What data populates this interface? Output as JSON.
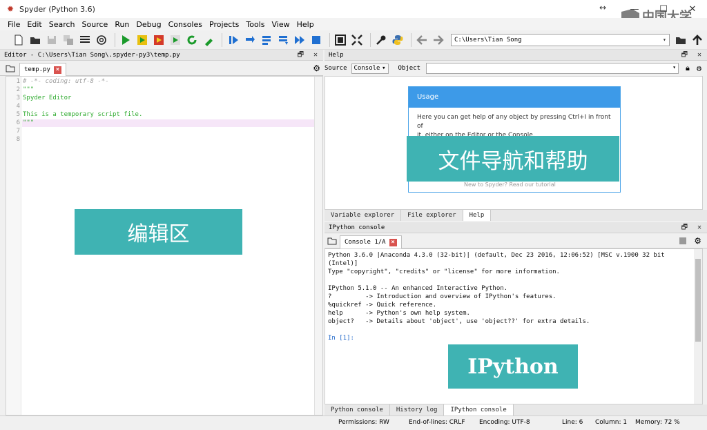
{
  "window": {
    "title": "Spyder (Python 3.6)",
    "resize_hint": "↔",
    "minimize": "—",
    "maximize": "☐",
    "close": "✕"
  },
  "watermark": {
    "text": "中国大学"
  },
  "menu": [
    "File",
    "Edit",
    "Search",
    "Source",
    "Run",
    "Debug",
    "Consoles",
    "Projects",
    "Tools",
    "View",
    "Help"
  ],
  "toolbar": {
    "path": "C:\\Users\\Tian Song"
  },
  "editor": {
    "pane_title": "Editor - C:\\Users\\Tian Song\\.spyder-py3\\temp.py",
    "pane_buttons": "🗗 ✕",
    "tab_label": "temp.py",
    "lines": [
      {
        "n": "1",
        "text": "# -*- coding: utf-8 -*-"
      },
      {
        "n": "2",
        "text": "\"\"\""
      },
      {
        "n": "3",
        "text": "Spyder Editor"
      },
      {
        "n": "4",
        "text": ""
      },
      {
        "n": "5",
        "text": "This is a temporary script file."
      },
      {
        "n": "6",
        "text": "\"\"\""
      },
      {
        "n": "7",
        "text": ""
      },
      {
        "n": "8",
        "text": ""
      }
    ],
    "overlay_label": "编辑区"
  },
  "help": {
    "pane_title": "Help",
    "pane_buttons": "🗗 ✕",
    "source_label": "Source",
    "source_value": "Console",
    "object_label": "Object",
    "usage_title": "Usage",
    "usage_text_1": "Here you can get help of any object by pressing Ctrl+I in front of",
    "usage_text_2": "it, either on the Editor or the Console.",
    "usage_footer": "New to Spyder? Read our tutorial",
    "overlay_label": "文件导航和帮助",
    "tabs": [
      "Variable explorer",
      "File explorer",
      "Help"
    ],
    "active_tab": "Help"
  },
  "console": {
    "pane_title": "IPython console",
    "pane_buttons": "🗗 ✕",
    "tab_label": "Console 1/A",
    "lines": [
      "Python 3.6.0 |Anaconda 4.3.0 (32-bit)| (default, Dec 23 2016, 12:06:52) [MSC v.1900 32 bit",
      "(Intel)]",
      "Type \"copyright\", \"credits\" or \"license\" for more information.",
      "",
      "IPython 5.1.0 -- An enhanced Interactive Python.",
      "?         -> Introduction and overview of IPython's features.",
      "%quickref -> Quick reference.",
      "help      -> Python's own help system.",
      "object?   -> Details about 'object', use 'object??' for extra details."
    ],
    "prompt": "In [1]:",
    "overlay_label": "IPython",
    "tabs": [
      "Python console",
      "History log",
      "IPython console"
    ],
    "active_tab": "IPython console"
  },
  "status": {
    "permissions": "Permissions: RW",
    "eol": "End-of-lines: CRLF",
    "encoding": "Encoding: UTF-8",
    "line": "Line: 6",
    "column": "Column: 1",
    "memory": "Memory: 72 %"
  },
  "colors": {
    "overlay": "#3fb3b3",
    "usage_header": "#3d9ae8",
    "run_green": "#1a9a2a",
    "debug_blue": "#1f6fd1"
  }
}
